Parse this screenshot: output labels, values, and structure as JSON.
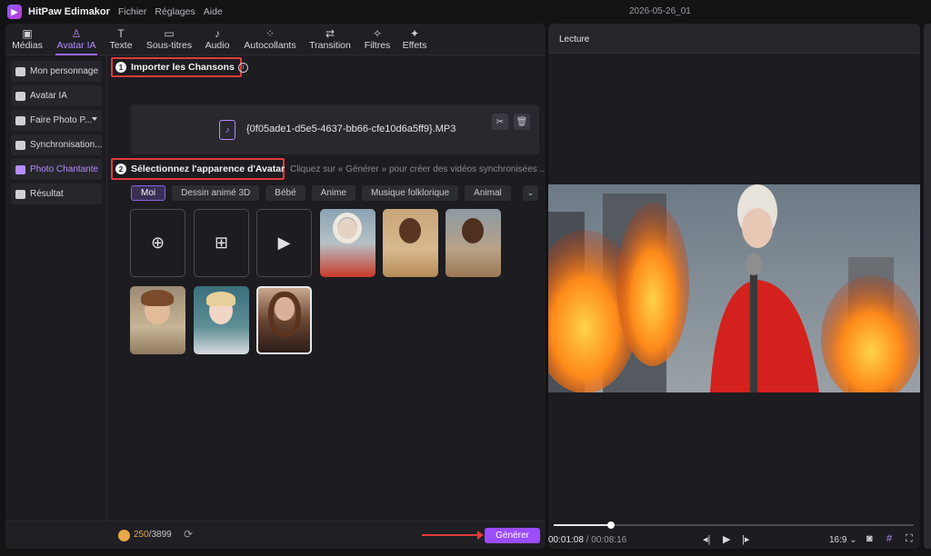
{
  "app": {
    "name": "HitPaw Edimakor",
    "menu": [
      "Fichier",
      "Réglages",
      "Aide"
    ],
    "project": "2026-05-26_01"
  },
  "toolbar": {
    "tabs": [
      {
        "label": "Médias",
        "icon": "media-icon"
      },
      {
        "label": "Avatar IA",
        "icon": "avatar-icon",
        "active": true
      },
      {
        "label": "Texte",
        "icon": "text-icon"
      },
      {
        "label": "Sous-titres",
        "icon": "subtitles-icon"
      },
      {
        "label": "Audio",
        "icon": "audio-icon"
      },
      {
        "label": "Autocollants",
        "icon": "stickers-icon"
      },
      {
        "label": "Transition",
        "icon": "transition-icon"
      },
      {
        "label": "Filtres",
        "icon": "filters-icon"
      },
      {
        "label": "Effets",
        "icon": "effects-icon"
      }
    ]
  },
  "sidebar": {
    "items": [
      {
        "label": "Mon personnage"
      },
      {
        "label": "Avatar IA"
      },
      {
        "label": "Faire Photo P..."
      },
      {
        "label": "Synchronisation..."
      },
      {
        "label": "Photo Chantante",
        "active": true
      },
      {
        "label": "Résultat"
      }
    ]
  },
  "section1": {
    "number": "1",
    "title": "Importer les Chansons",
    "file_name": "{0f05ade1-d5e5-4637-bb66-cfe10d6a5ff9}.MP3"
  },
  "section2": {
    "number": "2",
    "title": "Sélectionnez l'apparence d'Avatar",
    "hint": "Cliquez sur « Générer » pour créer des vidéos synchronisées ..."
  },
  "categories": [
    "Moi",
    "Dessin animé 3D",
    "Bébé",
    "Anime",
    "Musique folklorique",
    "Animal"
  ],
  "bottom": {
    "credits_used": "250",
    "credits_total": "/3899",
    "generate_label": "Générer"
  },
  "preview": {
    "title": "Lecture",
    "current_time": "00:01:08",
    "total_time": "/ 00:08:16",
    "progress": 0.16,
    "aspect_ratio": "16:9"
  }
}
